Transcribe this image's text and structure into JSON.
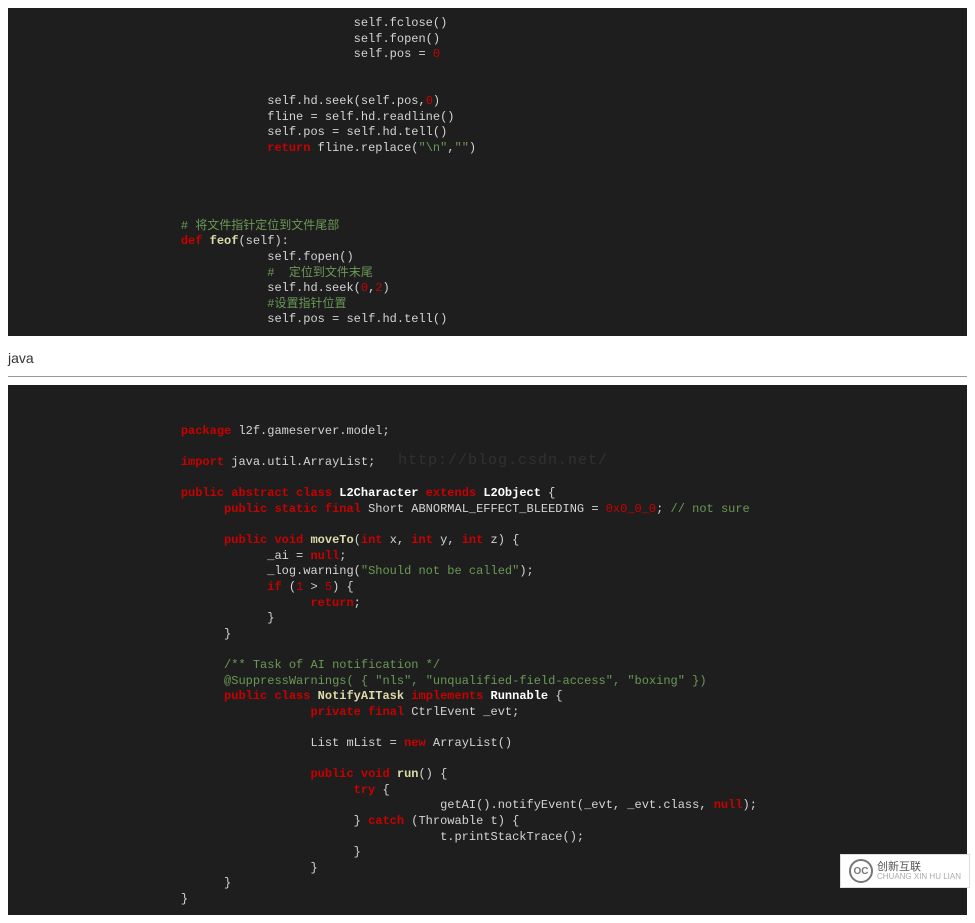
{
  "block1": {
    "lines": [
      {
        "indent": 16,
        "parts": [
          {
            "t": "self.fclose()",
            "c": "pln"
          }
        ]
      },
      {
        "indent": 16,
        "parts": [
          {
            "t": "self.fopen()",
            "c": "pln"
          }
        ]
      },
      {
        "indent": 16,
        "parts": [
          {
            "t": "self.pos = ",
            "c": "pln"
          },
          {
            "t": "0",
            "c": "err"
          }
        ]
      },
      {
        "indent": 0,
        "parts": [
          {
            "t": "",
            "c": "pln"
          }
        ]
      },
      {
        "indent": 0,
        "parts": [
          {
            "t": "",
            "c": "pln"
          }
        ]
      },
      {
        "indent": 12,
        "parts": [
          {
            "t": "self.hd.seek(self.pos,",
            "c": "pln"
          },
          {
            "t": "0",
            "c": "err"
          },
          {
            "t": ")",
            "c": "pln"
          }
        ]
      },
      {
        "indent": 12,
        "parts": [
          {
            "t": "fline = self.hd.readline()",
            "c": "pln"
          }
        ]
      },
      {
        "indent": 12,
        "parts": [
          {
            "t": "self.pos = self.hd.tell()",
            "c": "pln"
          }
        ]
      },
      {
        "indent": 12,
        "parts": [
          {
            "t": "return",
            "c": "kw"
          },
          {
            "t": " fline.replace(",
            "c": "pln"
          },
          {
            "t": "\"\\n\"",
            "c": "str"
          },
          {
            "t": ",",
            "c": "pln"
          },
          {
            "t": "\"\"",
            "c": "str"
          },
          {
            "t": ")",
            "c": "pln"
          }
        ]
      },
      {
        "indent": 0,
        "parts": [
          {
            "t": "",
            "c": "pln"
          }
        ]
      },
      {
        "indent": 0,
        "parts": [
          {
            "t": "",
            "c": "pln"
          }
        ]
      },
      {
        "indent": 0,
        "parts": [
          {
            "t": "",
            "c": "pln"
          }
        ]
      },
      {
        "indent": 0,
        "parts": [
          {
            "t": "",
            "c": "pln"
          }
        ]
      },
      {
        "indent": 8,
        "parts": [
          {
            "t": "# 将文件指针定位到文件尾部",
            "c": "cmt"
          }
        ]
      },
      {
        "indent": 8,
        "parts": [
          {
            "t": "def",
            "c": "kw"
          },
          {
            "t": " ",
            "c": "pln"
          },
          {
            "t": "feof",
            "c": "fn"
          },
          {
            "t": "(self):",
            "c": "pln"
          }
        ]
      },
      {
        "indent": 12,
        "parts": [
          {
            "t": "self.fopen()",
            "c": "pln"
          }
        ]
      },
      {
        "indent": 12,
        "parts": [
          {
            "t": "#  定位到文件末尾",
            "c": "cmt"
          }
        ]
      },
      {
        "indent": 12,
        "parts": [
          {
            "t": "self.hd.seek(",
            "c": "pln"
          },
          {
            "t": "0",
            "c": "err"
          },
          {
            "t": ",",
            "c": "pln"
          },
          {
            "t": "2",
            "c": "err"
          },
          {
            "t": ")",
            "c": "pln"
          }
        ]
      },
      {
        "indent": 12,
        "parts": [
          {
            "t": "#设置指针位置",
            "c": "cmt"
          }
        ]
      },
      {
        "indent": 12,
        "parts": [
          {
            "t": "self.pos = self.hd.tell()",
            "c": "pln"
          }
        ]
      }
    ]
  },
  "section_heading": "java",
  "watermark": "http://blog.csdn.net/",
  "block2": {
    "lines": [
      {
        "indent": 8,
        "parts": [
          {
            "t": "package",
            "c": "kw"
          },
          {
            "t": " l2f.gameserver.model;",
            "c": "pln"
          }
        ]
      },
      {
        "indent": 0,
        "parts": [
          {
            "t": "",
            "c": "pln"
          }
        ]
      },
      {
        "indent": 8,
        "parts": [
          {
            "t": "import",
            "c": "kw"
          },
          {
            "t": " java.util.ArrayList;",
            "c": "pln"
          }
        ]
      },
      {
        "indent": 0,
        "parts": [
          {
            "t": "",
            "c": "pln"
          }
        ]
      },
      {
        "indent": 8,
        "parts": [
          {
            "t": "public abstract class",
            "c": "kw"
          },
          {
            "t": " ",
            "c": "pln"
          },
          {
            "t": "L2Character",
            "c": "cls"
          },
          {
            "t": " ",
            "c": "pln"
          },
          {
            "t": "extends",
            "c": "kw"
          },
          {
            "t": " ",
            "c": "pln"
          },
          {
            "t": "L2Object",
            "c": "cls"
          },
          {
            "t": " {",
            "c": "pln"
          }
        ]
      },
      {
        "indent": 10,
        "parts": [
          {
            "t": "public static final",
            "c": "kw"
          },
          {
            "t": " Short ABNORMAL_EFFECT_BLEEDING = ",
            "c": "pln"
          },
          {
            "t": "0x0_0_0",
            "c": "err"
          },
          {
            "t": "; ",
            "c": "pln"
          },
          {
            "t": "// not sure",
            "c": "cmt"
          }
        ]
      },
      {
        "indent": 0,
        "parts": [
          {
            "t": "",
            "c": "pln"
          }
        ]
      },
      {
        "indent": 10,
        "parts": [
          {
            "t": "public void",
            "c": "kw"
          },
          {
            "t": " ",
            "c": "pln"
          },
          {
            "t": "moveTo",
            "c": "fn"
          },
          {
            "t": "(",
            "c": "pln"
          },
          {
            "t": "int",
            "c": "kw"
          },
          {
            "t": " x, ",
            "c": "pln"
          },
          {
            "t": "int",
            "c": "kw"
          },
          {
            "t": " y, ",
            "c": "pln"
          },
          {
            "t": "int",
            "c": "kw"
          },
          {
            "t": " z) {",
            "c": "pln"
          }
        ]
      },
      {
        "indent": 12,
        "parts": [
          {
            "t": "_ai = ",
            "c": "pln"
          },
          {
            "t": "null",
            "c": "null"
          },
          {
            "t": ";",
            "c": "pln"
          }
        ]
      },
      {
        "indent": 12,
        "parts": [
          {
            "t": "_log.warning(",
            "c": "pln"
          },
          {
            "t": "\"Should not be called\"",
            "c": "str"
          },
          {
            "t": ");",
            "c": "pln"
          }
        ]
      },
      {
        "indent": 12,
        "parts": [
          {
            "t": "if",
            "c": "kw"
          },
          {
            "t": " (",
            "c": "pln"
          },
          {
            "t": "1",
            "c": "err"
          },
          {
            "t": " > ",
            "c": "pln"
          },
          {
            "t": "5",
            "c": "err"
          },
          {
            "t": ") {",
            "c": "pln"
          }
        ]
      },
      {
        "indent": 14,
        "parts": [
          {
            "t": "return",
            "c": "kw"
          },
          {
            "t": ";",
            "c": "pln"
          }
        ]
      },
      {
        "indent": 12,
        "parts": [
          {
            "t": "}",
            "c": "pln"
          }
        ]
      },
      {
        "indent": 10,
        "parts": [
          {
            "t": "}",
            "c": "pln"
          }
        ]
      },
      {
        "indent": 0,
        "parts": [
          {
            "t": "",
            "c": "pln"
          }
        ]
      },
      {
        "indent": 10,
        "parts": [
          {
            "t": "/** Task of AI notification */",
            "c": "cmt"
          }
        ]
      },
      {
        "indent": 10,
        "parts": [
          {
            "t": "@SuppressWarnings( { ",
            "c": "ann"
          },
          {
            "t": "\"nls\"",
            "c": "str"
          },
          {
            "t": ", ",
            "c": "ann"
          },
          {
            "t": "\"unqualified-field-access\"",
            "c": "str"
          },
          {
            "t": ", ",
            "c": "ann"
          },
          {
            "t": "\"boxing\"",
            "c": "str"
          },
          {
            "t": " })",
            "c": "ann"
          }
        ]
      },
      {
        "indent": 10,
        "parts": [
          {
            "t": "public class",
            "c": "kw"
          },
          {
            "t": " ",
            "c": "pln"
          },
          {
            "t": "NotifyAITask",
            "c": "fn"
          },
          {
            "t": " ",
            "c": "pln"
          },
          {
            "t": "implements",
            "c": "kw"
          },
          {
            "t": " ",
            "c": "pln"
          },
          {
            "t": "Runnable",
            "c": "cls"
          },
          {
            "t": " {",
            "c": "pln"
          }
        ]
      },
      {
        "indent": 14,
        "parts": [
          {
            "t": "private final",
            "c": "kw"
          },
          {
            "t": " CtrlEvent _evt;",
            "c": "pln"
          }
        ]
      },
      {
        "indent": 0,
        "parts": [
          {
            "t": "",
            "c": "pln"
          }
        ]
      },
      {
        "indent": 14,
        "parts": [
          {
            "t": "List mList = ",
            "c": "pln"
          },
          {
            "t": "new",
            "c": "kw"
          },
          {
            "t": " ArrayList()",
            "c": "pln"
          }
        ]
      },
      {
        "indent": 0,
        "parts": [
          {
            "t": "",
            "c": "pln"
          }
        ]
      },
      {
        "indent": 14,
        "parts": [
          {
            "t": "public void",
            "c": "kw"
          },
          {
            "t": " ",
            "c": "pln"
          },
          {
            "t": "run",
            "c": "fn"
          },
          {
            "t": "() {",
            "c": "pln"
          }
        ]
      },
      {
        "indent": 16,
        "parts": [
          {
            "t": "try",
            "c": "kw"
          },
          {
            "t": " {",
            "c": "pln"
          }
        ]
      },
      {
        "indent": 20,
        "parts": [
          {
            "t": "getAI().notifyEvent(_evt, _evt.class, ",
            "c": "pln"
          },
          {
            "t": "null",
            "c": "null"
          },
          {
            "t": ");",
            "c": "pln"
          }
        ]
      },
      {
        "indent": 16,
        "parts": [
          {
            "t": "} ",
            "c": "pln"
          },
          {
            "t": "catch",
            "c": "kw"
          },
          {
            "t": " (Throwable t) {",
            "c": "pln"
          }
        ]
      },
      {
        "indent": 20,
        "parts": [
          {
            "t": "t.printStackTrace();",
            "c": "pln"
          }
        ]
      },
      {
        "indent": 16,
        "parts": [
          {
            "t": "}",
            "c": "pln"
          }
        ]
      },
      {
        "indent": 14,
        "parts": [
          {
            "t": "}",
            "c": "pln"
          }
        ]
      },
      {
        "indent": 10,
        "parts": [
          {
            "t": "}",
            "c": "pln"
          }
        ]
      },
      {
        "indent": 8,
        "parts": [
          {
            "t": "}",
            "c": "pln"
          }
        ]
      }
    ]
  },
  "logo": {
    "cn": "创新互联",
    "en": "CHUANG XIN HU LIAN",
    "mark": "OC"
  }
}
